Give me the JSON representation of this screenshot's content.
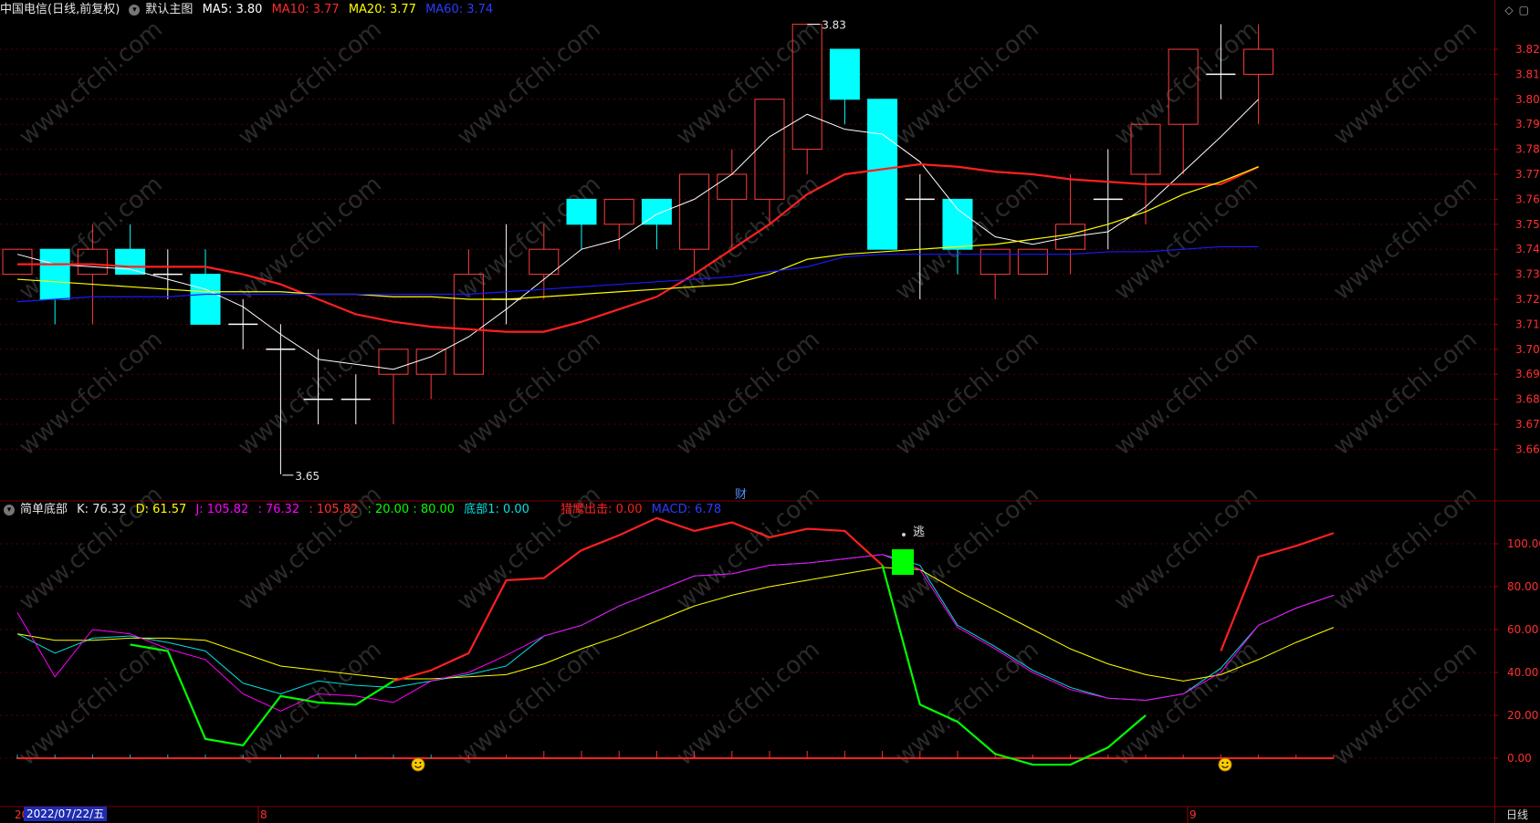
{
  "main_header": {
    "stock": "中国电信(日线,前复权)",
    "template": "默认主图",
    "ma5": "MA5: 3.80",
    "ma10": "MA10: 3.77",
    "ma20": "MA20: 3.77",
    "ma60": "MA60: 3.74"
  },
  "sub_header": {
    "indicator": "简单底部",
    "k": "K: 76.32",
    "d": "D: 61.57",
    "j": "J: 105.82",
    "v1": ": 76.32",
    "v2": ": 105.82",
    "v3": ": 20.00 : 80.00",
    "bottom1": "底部1: 0.00",
    "eagle": "猎鹰出击: 0.00",
    "macd": "MACD: 6.78"
  },
  "annotations": {
    "high": "3.83",
    "low": "3.65",
    "finance_marker": "财",
    "escape_marker": "逃"
  },
  "footer": {
    "date": "2022/07/22/五",
    "period": "日线",
    "month_8": "8",
    "month_9": "9",
    "year_prefix": "20"
  },
  "watermark": "www.cfchi.com",
  "colors": {
    "up": "#ff3b3b",
    "down": "#00ffff",
    "ma5": "#ffffff",
    "ma10": "#ff2020",
    "ma20": "#ffff00",
    "ma60": "#1a1aff",
    "k": "#00e0e0",
    "d": "#ffff00",
    "j": "#ff00ff",
    "red_line": "#ff2020",
    "green_line": "#00ff00",
    "axis_text": "#ff3030"
  },
  "chart_data": [
    {
      "type": "candlestick",
      "ylim": [
        3.65,
        3.83
      ],
      "y_ticks": [
        3.66,
        3.67,
        3.68,
        3.69,
        3.7,
        3.71,
        3.72,
        3.73,
        3.74,
        3.75,
        3.76,
        3.77,
        3.78,
        3.79,
        3.8,
        3.81,
        3.82
      ],
      "candles": [
        {
          "o": 3.73,
          "h": 3.74,
          "l": 3.73,
          "c": 3.74
        },
        {
          "o": 3.74,
          "h": 3.74,
          "l": 3.71,
          "c": 3.72
        },
        {
          "o": 3.73,
          "h": 3.75,
          "l": 3.71,
          "c": 3.74
        },
        {
          "o": 3.74,
          "h": 3.75,
          "l": 3.73,
          "c": 3.73
        },
        {
          "o": 3.73,
          "h": 3.74,
          "l": 3.72,
          "c": 3.73
        },
        {
          "o": 3.73,
          "h": 3.74,
          "l": 3.71,
          "c": 3.71
        },
        {
          "o": 3.71,
          "h": 3.72,
          "l": 3.7,
          "c": 3.71
        },
        {
          "o": 3.7,
          "h": 3.71,
          "l": 3.65,
          "c": 3.7
        },
        {
          "o": 3.68,
          "h": 3.7,
          "l": 3.67,
          "c": 3.68
        },
        {
          "o": 3.68,
          "h": 3.69,
          "l": 3.67,
          "c": 3.68
        },
        {
          "o": 3.69,
          "h": 3.7,
          "l": 3.67,
          "c": 3.7
        },
        {
          "o": 3.69,
          "h": 3.7,
          "l": 3.68,
          "c": 3.7
        },
        {
          "o": 3.69,
          "h": 3.74,
          "l": 3.69,
          "c": 3.73
        },
        {
          "o": 3.72,
          "h": 3.75,
          "l": 3.71,
          "c": 3.72
        },
        {
          "o": 3.73,
          "h": 3.75,
          "l": 3.72,
          "c": 3.74
        },
        {
          "o": 3.76,
          "h": 3.76,
          "l": 3.74,
          "c": 3.75
        },
        {
          "o": 3.75,
          "h": 3.76,
          "l": 3.74,
          "c": 3.76
        },
        {
          "o": 3.76,
          "h": 3.76,
          "l": 3.74,
          "c": 3.75
        },
        {
          "o": 3.74,
          "h": 3.77,
          "l": 3.73,
          "c": 3.77
        },
        {
          "o": 3.76,
          "h": 3.78,
          "l": 3.74,
          "c": 3.77
        },
        {
          "o": 3.76,
          "h": 3.8,
          "l": 3.75,
          "c": 3.8
        },
        {
          "o": 3.78,
          "h": 3.83,
          "l": 3.77,
          "c": 3.83
        },
        {
          "o": 3.82,
          "h": 3.82,
          "l": 3.79,
          "c": 3.8
        },
        {
          "o": 3.8,
          "h": 3.8,
          "l": 3.74,
          "c": 3.74
        },
        {
          "o": 3.76,
          "h": 3.77,
          "l": 3.72,
          "c": 3.76
        },
        {
          "o": 3.76,
          "h": 3.76,
          "l": 3.73,
          "c": 3.74
        },
        {
          "o": 3.73,
          "h": 3.74,
          "l": 3.72,
          "c": 3.74
        },
        {
          "o": 3.73,
          "h": 3.74,
          "l": 3.73,
          "c": 3.74
        },
        {
          "o": 3.74,
          "h": 3.77,
          "l": 3.73,
          "c": 3.75
        },
        {
          "o": 3.76,
          "h": 3.78,
          "l": 3.74,
          "c": 3.76
        },
        {
          "o": 3.77,
          "h": 3.79,
          "l": 3.75,
          "c": 3.79
        },
        {
          "o": 3.79,
          "h": 3.82,
          "l": 3.77,
          "c": 3.82
        },
        {
          "o": 3.81,
          "h": 3.83,
          "l": 3.8,
          "c": 3.81
        },
        {
          "o": 3.81,
          "h": 3.83,
          "l": 3.79,
          "c": 3.82
        }
      ],
      "series": [
        {
          "name": "MA5",
          "values": [
            3.738,
            3.734,
            3.733,
            3.732,
            3.728,
            3.724,
            3.717,
            3.706,
            3.696,
            3.694,
            3.692,
            3.697,
            3.705,
            3.716,
            3.728,
            3.74,
            3.744,
            3.754,
            3.76,
            3.77,
            3.785,
            3.794,
            3.788,
            3.786,
            3.775,
            3.756,
            3.745,
            3.742,
            3.745,
            3.747,
            3.757,
            3.771,
            3.785,
            3.8
          ]
        },
        {
          "name": "MA10",
          "values": [
            3.734,
            3.734,
            3.734,
            3.733,
            3.733,
            3.733,
            3.73,
            3.726,
            3.72,
            3.714,
            3.711,
            3.709,
            3.708,
            3.707,
            3.707,
            3.711,
            3.716,
            3.721,
            3.73,
            3.74,
            3.75,
            3.762,
            3.77,
            3.772,
            3.774,
            3.773,
            3.771,
            3.77,
            3.768,
            3.767,
            3.766,
            3.766,
            3.766,
            3.773
          ]
        },
        {
          "name": "MA20",
          "values": [
            3.728,
            3.727,
            3.726,
            3.725,
            3.724,
            3.723,
            3.723,
            3.723,
            3.722,
            3.722,
            3.721,
            3.721,
            3.72,
            3.72,
            3.721,
            3.722,
            3.723,
            3.724,
            3.725,
            3.726,
            3.73,
            3.736,
            3.738,
            3.739,
            3.74,
            3.741,
            3.742,
            3.744,
            3.746,
            3.75,
            3.755,
            3.762,
            3.767,
            3.773
          ]
        },
        {
          "name": "MA60",
          "values": [
            3.719,
            3.72,
            3.721,
            3.721,
            3.721,
            3.722,
            3.722,
            3.722,
            3.722,
            3.722,
            3.722,
            3.722,
            3.722,
            3.723,
            3.724,
            3.725,
            3.726,
            3.727,
            3.728,
            3.729,
            3.731,
            3.733,
            3.737,
            3.738,
            3.738,
            3.738,
            3.738,
            3.738,
            3.738,
            3.739,
            3.739,
            3.74,
            3.741,
            3.741
          ]
        }
      ]
    },
    {
      "type": "line",
      "ylim": [
        -5,
        115
      ],
      "y_ticks": [
        0,
        20,
        40,
        60,
        80,
        100
      ],
      "series": [
        {
          "name": "K",
          "values": [
            58,
            49,
            56,
            57,
            54,
            50,
            35,
            30,
            36,
            34,
            33,
            36,
            39,
            43,
            57,
            62,
            71,
            78,
            85,
            86,
            90,
            91,
            93,
            95,
            90,
            62,
            52,
            41,
            33,
            28,
            27,
            30,
            42,
            62,
            70,
            76
          ]
        },
        {
          "name": "D",
          "values": [
            58,
            55,
            55,
            56,
            56,
            55,
            49,
            43,
            41,
            39,
            37,
            37,
            38,
            39,
            44,
            51,
            57,
            64,
            71,
            76,
            80,
            83,
            86,
            89,
            88,
            78,
            69,
            60,
            51,
            44,
            39,
            36,
            39,
            46,
            54,
            61
          ]
        },
        {
          "name": "J",
          "values": [
            68,
            38,
            60,
            58,
            51,
            46,
            30,
            22,
            30,
            29,
            26,
            36,
            40,
            48,
            57,
            62,
            71,
            78,
            85,
            86,
            90,
            91,
            93,
            95,
            88,
            61,
            51,
            40,
            32,
            28,
            27,
            30,
            40,
            62,
            70,
            76
          ]
        },
        {
          "name": "K2",
          "values": [
            null,
            null,
            null,
            null,
            null,
            null,
            null,
            null,
            null,
            null,
            36,
            41,
            49,
            83,
            84,
            97,
            104,
            112,
            106,
            110,
            103,
            107,
            106,
            90,
            null,
            null,
            null,
            null,
            null,
            null,
            null,
            null,
            50,
            94,
            99,
            105
          ]
        },
        {
          "name": "B1",
          "values": [
            null,
            null,
            null,
            53,
            50,
            9,
            6,
            29,
            26,
            25,
            36,
            null,
            null,
            null,
            null,
            null,
            null,
            null,
            null,
            null,
            null,
            null,
            null,
            90,
            25,
            17,
            2,
            -3,
            -3,
            5,
            20,
            null,
            null,
            null,
            null,
            null
          ]
        }
      ]
    }
  ]
}
